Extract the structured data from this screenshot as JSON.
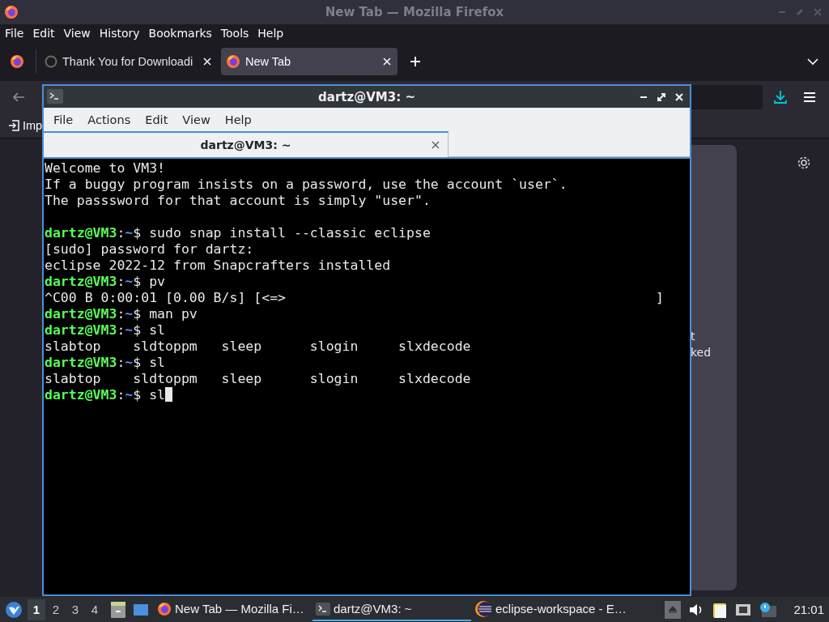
{
  "browser": {
    "title": "New Tab — Mozilla Firefox",
    "menu": [
      "File",
      "Edit",
      "View",
      "History",
      "Bookmarks",
      "Tools",
      "Help"
    ],
    "tabs": [
      {
        "label": "Thank You for Downloadi",
        "selected": false
      },
      {
        "label": "New Tab",
        "selected": true
      }
    ],
    "bookmarks": [
      "Imp"
    ],
    "content_texts": [
      "t",
      "ked"
    ]
  },
  "terminal": {
    "title": "dartz@VM3: ~",
    "menu": [
      "File",
      "Actions",
      "Edit",
      "View",
      "Help"
    ],
    "tabs": [
      {
        "label": "dartz@VM3: ~",
        "selected": true
      }
    ],
    "lines": [
      {
        "kind": "output",
        "text": "Welcome to VM3!"
      },
      {
        "kind": "output",
        "text": "If a buggy program insists on a password, use the account `user`."
      },
      {
        "kind": "output",
        "text": "The passsword for that account is simply \"user\"."
      },
      {
        "kind": "blank"
      },
      {
        "kind": "prompt",
        "user": "dartz@VM3",
        "sep": ":",
        "path": "~",
        "symbol": "$",
        "command": "sudo snap install --classic eclipse",
        "cursor": false
      },
      {
        "kind": "output",
        "text": "[sudo] password for dartz:"
      },
      {
        "kind": "output",
        "text": "eclipse 2022-12 from Snapcrafters installed"
      },
      {
        "kind": "prompt",
        "user": "dartz@VM3",
        "sep": ":",
        "path": "~",
        "symbol": "$",
        "command": "pv",
        "cursor": false
      },
      {
        "kind": "output",
        "text": "^C00 B 0:00:01 [0.00 B/s] [<=>                                              ]"
      },
      {
        "kind": "prompt",
        "user": "dartz@VM3",
        "sep": ":",
        "path": "~",
        "symbol": "$",
        "command": "man pv",
        "cursor": false
      },
      {
        "kind": "prompt",
        "user": "dartz@VM3",
        "sep": ":",
        "path": "~",
        "symbol": "$",
        "command": "sl",
        "cursor": false
      },
      {
        "kind": "output",
        "text": "slabtop    sldtoppm   sleep      slogin     slxdecode"
      },
      {
        "kind": "prompt",
        "user": "dartz@VM3",
        "sep": ":",
        "path": "~",
        "symbol": "$",
        "command": "sl",
        "cursor": false
      },
      {
        "kind": "output",
        "text": "slabtop    sldtoppm   sleep      slogin     slxdecode"
      },
      {
        "kind": "prompt",
        "user": "dartz@VM3",
        "sep": ":",
        "path": "~",
        "symbol": "$",
        "command": "sl",
        "cursor": true
      }
    ]
  },
  "taskbar": {
    "workspaces": [
      {
        "label": "1",
        "selected": true
      },
      {
        "label": "2",
        "selected": false
      },
      {
        "label": "3",
        "selected": false
      },
      {
        "label": "4",
        "selected": false
      }
    ],
    "tasks": [
      {
        "kind": "browser",
        "label": "New Tab — Mozilla Fi…",
        "selected": false
      },
      {
        "kind": "terminal",
        "label": "dartz@VM3: ~",
        "selected": true
      },
      {
        "kind": "ide",
        "label": "eclipse-workspace - E…",
        "selected": false
      }
    ],
    "clock": "21:01"
  }
}
